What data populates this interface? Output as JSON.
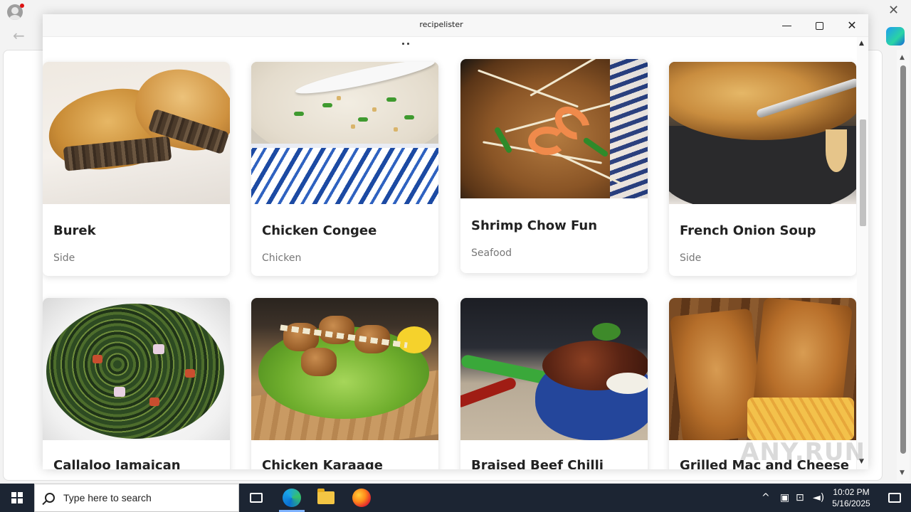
{
  "app": {
    "title": "recipelister"
  },
  "recipes": [
    {
      "name": "Burek",
      "category": "Side"
    },
    {
      "name": "Chicken Congee",
      "category": "Chicken"
    },
    {
      "name": "Shrimp Chow Fun",
      "category": "Seafood"
    },
    {
      "name": "French Onion Soup",
      "category": "Side"
    },
    {
      "name": "Callaloo Jamaican"
    },
    {
      "name": "Chicken Karaage"
    },
    {
      "name": "Braised Beef Chilli"
    },
    {
      "name": "Grilled Mac and Cheese"
    }
  ],
  "watermark": "ANY.RUN",
  "taskbar": {
    "search_placeholder": "Type here to search",
    "time": "10:02 PM",
    "date": "5/16/2025"
  },
  "icons": {
    "browser_profile": "profile-avatar-icon",
    "browser_back": "back-arrow-icon",
    "browser_close": "close-icon",
    "copilot": "copilot-icon",
    "start": "windows-logo-icon",
    "search": "search-icon",
    "task_view": "task-view-icon",
    "edge": "edge-icon",
    "file_explorer": "folder-icon",
    "firefox": "firefox-icon"
  }
}
